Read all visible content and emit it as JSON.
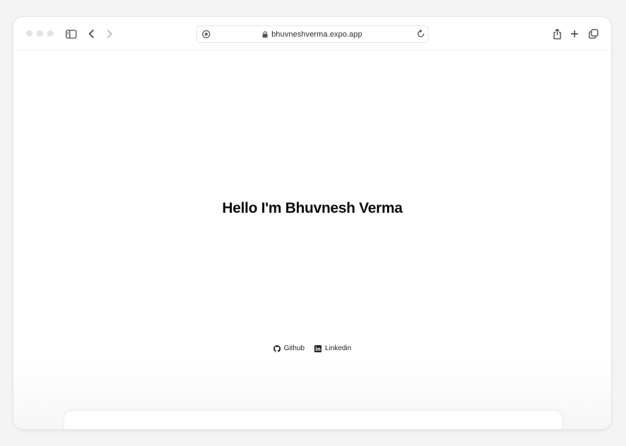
{
  "browser": {
    "url": "bhuvneshverma.expo.app",
    "icons": {
      "sidebar": "sidebar-icon",
      "back": "chevron-left-icon",
      "forward": "chevron-right-icon",
      "site_settings": "site-settings-icon",
      "lock": "lock-icon",
      "reload": "reload-icon",
      "share": "share-icon",
      "new_tab": "plus-icon",
      "tabs": "tabs-overview-icon"
    }
  },
  "page": {
    "headline": "Hello I'm Bhuvnesh Verma",
    "links": [
      {
        "label": "Github",
        "icon": "github-icon"
      },
      {
        "label": "Linkedin",
        "icon": "linkedin-icon"
      }
    ]
  },
  "colors": {
    "background": "#f4f4f5",
    "text": "#0b0b0c",
    "toolbar_icon": "#4a4a4f",
    "traffic_light": "#e3e3e5"
  }
}
